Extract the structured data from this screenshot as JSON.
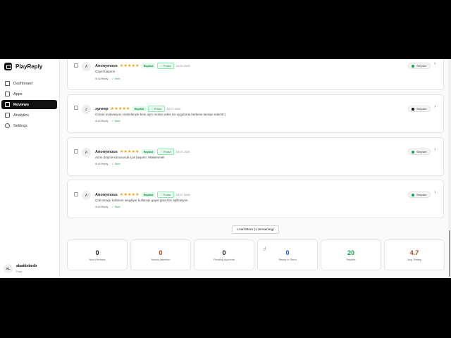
{
  "brand": {
    "name": "PlayReply"
  },
  "sidebar": {
    "items": [
      {
        "label": "Dashboard",
        "icon": "dashboard-icon"
      },
      {
        "label": "Apps",
        "icon": "apps-icon"
      },
      {
        "label": "Reviews",
        "icon": "reviews-icon",
        "active": true
      },
      {
        "label": "Analytics",
        "icon": "analytics-icon"
      },
      {
        "label": "Settings",
        "icon": "settings-icon"
      }
    ]
  },
  "user": {
    "initials": "AL",
    "name": "alaattinbedir",
    "plan": "Free"
  },
  "reviews": [
    {
      "initial": "A",
      "name": "Anonymous",
      "stars": "★★★★★",
      "status": "Replied",
      "category": "♡ Praise",
      "date": "04.09.2025",
      "text": "Gayet başarılı",
      "ai": "⊘ AI Reply",
      "sent": "✓ Sent",
      "device": "Sleipster",
      "device_icon": "android-icon"
    },
    {
      "initial": "Z",
      "name": "zyneep",
      "stars": "★★★★★",
      "status": "Replied",
      "category": "♡ Praise",
      "date": "18.07.2025",
      "text": "Günün motivasyon cümleleriyle beni aşırı motive eden bir uygulama herkese tavsiye ederim:)",
      "ai": "⊘ AI Reply",
      "sent": "✓ Sent",
      "device": "Sleipster",
      "device_icon": "apple-icon"
    },
    {
      "initial": "A",
      "name": "Anonymous",
      "stars": "★★★★★",
      "status": "Replied",
      "category": "♡ Praise",
      "date": "18.07.2025",
      "text": "Adım döşme konusunda çok başarılı. Mükemmel!",
      "ai": "⊘ AI Reply",
      "sent": "✓ Sent",
      "device": "Sleipster",
      "device_icon": "android-icon"
    },
    {
      "initial": "A",
      "name": "Anonymous",
      "stars": "★★★★★",
      "status": "Replied",
      "category": "♡ Praise",
      "date": "18.07.2025",
      "text": "Çok amaçlı kullanım sergiliyor kullanışlı gayet güzel bir aplikasyon.",
      "ai": "⊘ AI Reply",
      "sent": "✓ Sent",
      "device": "Sleipster",
      "device_icon": "android-icon"
    }
  ],
  "load_more": "Load More (1 remaining)",
  "stats": [
    {
      "value": "0",
      "label": "New Reviews",
      "color": "#111111"
    },
    {
      "value": "0",
      "label": "Needs Attention",
      "color": "#c2410c"
    },
    {
      "value": "0",
      "label": "Pending Approval",
      "color": "#111111"
    },
    {
      "value": "0",
      "label": "Ready to Send",
      "color": "#1d4ed8"
    },
    {
      "value": "20",
      "label": "Replied",
      "color": "#16a34a"
    },
    {
      "value": "4.7",
      "label": "Avg. Rating",
      "color": "#c2410c"
    }
  ],
  "colors": {
    "accent": "#111111",
    "star": "#f59e0b",
    "success": "#16a34a"
  }
}
